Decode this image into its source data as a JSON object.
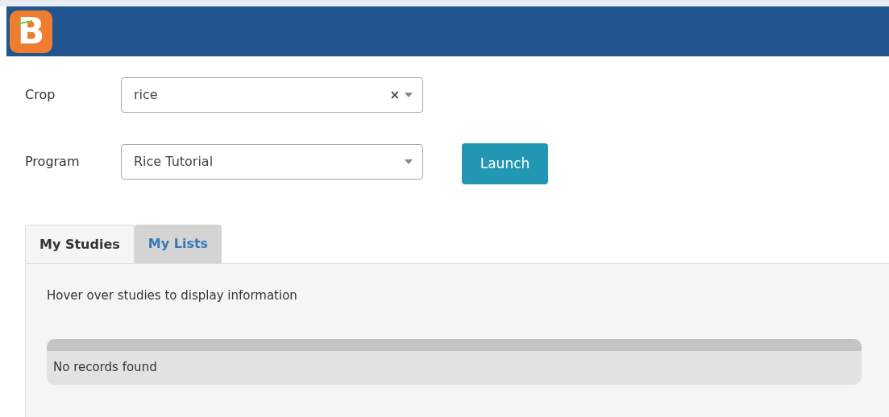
{
  "header": {
    "logo_text": "B"
  },
  "form": {
    "fields": [
      {
        "label": "Crop",
        "value": "rice",
        "clear": "×"
      },
      {
        "label": "Program",
        "value": "Rice Tutorial"
      }
    ],
    "launch_button": "Launch"
  },
  "tabs": [
    {
      "label": "My Studies",
      "selected": true
    },
    {
      "label": "My Lists",
      "selected": false
    }
  ],
  "panel": {
    "hint": "Hover over studies to display information",
    "table": {
      "empty_message": "No records found"
    }
  }
}
